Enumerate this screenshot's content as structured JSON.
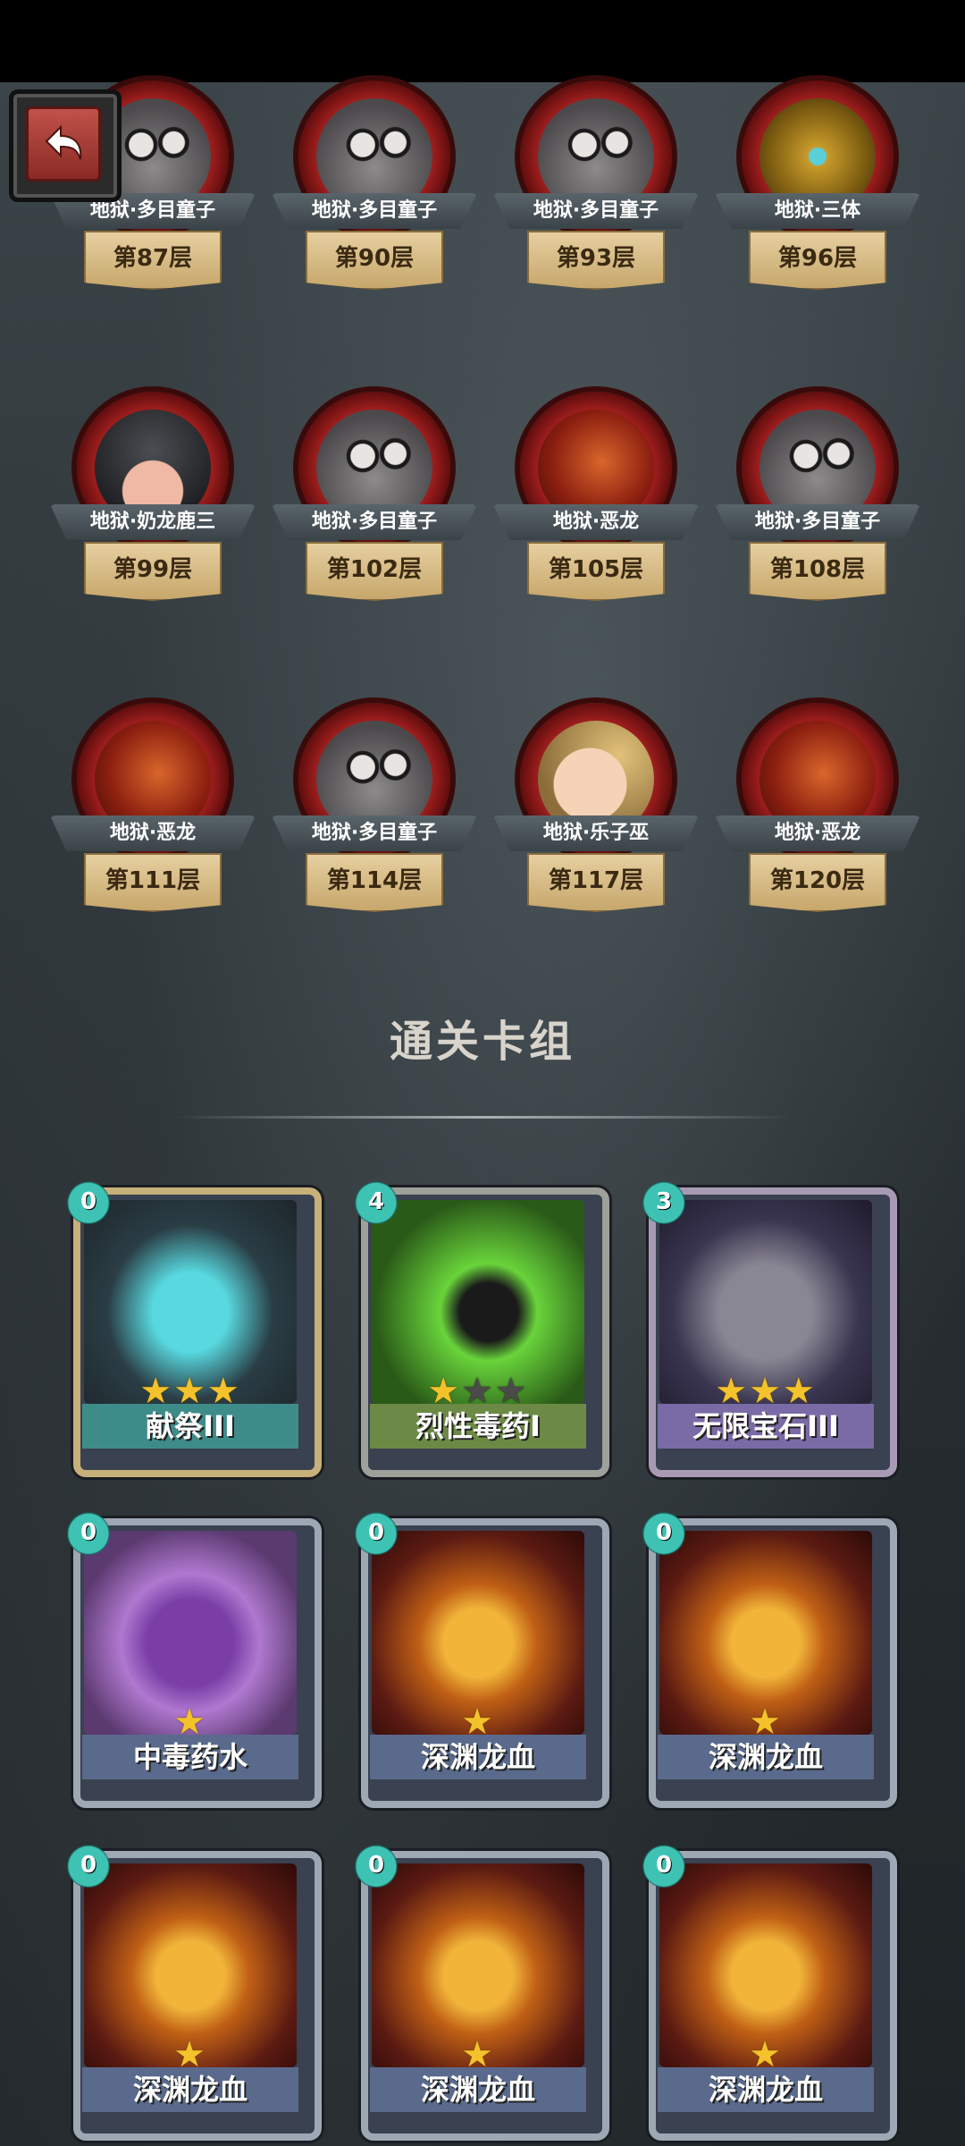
{
  "bosses": [
    {
      "name": "地狱·多目童子",
      "floor": "第87层",
      "icon": "many-eyed-child-portrait"
    },
    {
      "name": "地狱·多目童子",
      "floor": "第90层",
      "icon": "many-eyed-child-portrait"
    },
    {
      "name": "地狱·多目童子",
      "floor": "第93层",
      "icon": "many-eyed-child-portrait"
    },
    {
      "name": "地狱·三体",
      "floor": "第96层",
      "icon": "golden-robot-portrait"
    },
    {
      "name": "地狱·奶龙鹿三",
      "floor": "第99层",
      "icon": "helmet-baby-portrait"
    },
    {
      "name": "地狱·多目童子",
      "floor": "第102层",
      "icon": "many-eyed-child-portrait"
    },
    {
      "name": "地狱·恶龙",
      "floor": "第105层",
      "icon": "dragon-portrait"
    },
    {
      "name": "地狱·多目童子",
      "floor": "第108层",
      "icon": "many-eyed-child-portrait"
    },
    {
      "name": "地狱·恶龙",
      "floor": "第111层",
      "icon": "dragon-portrait"
    },
    {
      "name": "地狱·多目童子",
      "floor": "第114层",
      "icon": "many-eyed-child-portrait"
    },
    {
      "name": "地狱·乐子巫",
      "floor": "第117层",
      "icon": "blonde-kid-portrait"
    },
    {
      "name": "地狱·恶龙",
      "floor": "第120层",
      "icon": "dragon-portrait"
    }
  ],
  "section_title": "通关卡组",
  "cards": [
    {
      "name": "献祭III",
      "cost": "0",
      "stars": 3,
      "stars_max": 3
    },
    {
      "name": "烈性毒药I",
      "cost": "4",
      "stars": 1,
      "stars_max": 3
    },
    {
      "name": "无限宝石III",
      "cost": "3",
      "stars": 3,
      "stars_max": 3
    },
    {
      "name": "中毒药水",
      "cost": "0",
      "stars": 1,
      "stars_max": 1
    },
    {
      "name": "深渊龙血",
      "cost": "0",
      "stars": 1,
      "stars_max": 1
    },
    {
      "name": "深渊龙血",
      "cost": "0",
      "stars": 1,
      "stars_max": 1
    },
    {
      "name": "深渊龙血",
      "cost": "0",
      "stars": 1,
      "stars_max": 1
    },
    {
      "name": "深渊龙血",
      "cost": "0",
      "stars": 1,
      "stars_max": 1
    },
    {
      "name": "深渊龙血",
      "cost": "0",
      "stars": 1,
      "stars_max": 1
    }
  ],
  "colors": {
    "accent_gold": "#f4c22b",
    "mana_teal": "#3ec2b4",
    "boss_ring": "#9b1d1d"
  }
}
